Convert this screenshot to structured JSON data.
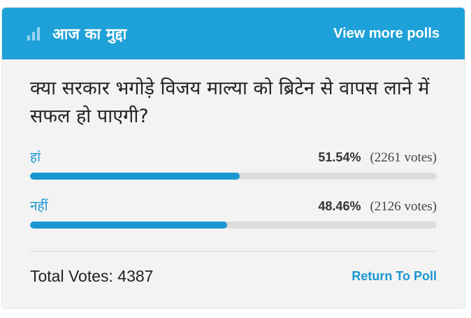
{
  "header": {
    "title": "आज का मुद्दा",
    "view_more_label": "View more polls",
    "icon": "poll-bars-icon"
  },
  "poll": {
    "question": "क्या सरकार भगोड़े विजय माल्या को ब्रिटेन से वापस लाने में सफल हो पाएगी?",
    "options": [
      {
        "label": "हां",
        "percent_text": "51.54%",
        "votes_text": "(2261 votes)",
        "percent": 51.54
      },
      {
        "label": "नहीं",
        "percent_text": "48.46%",
        "votes_text": "(2126 votes)",
        "percent": 48.46
      }
    ],
    "total_text": "Total Votes: 4387",
    "return_label": "Return To Poll"
  },
  "colors": {
    "accent": "#1ea1d8",
    "bar": "#1a96d1",
    "track": "#dcdcdc"
  }
}
